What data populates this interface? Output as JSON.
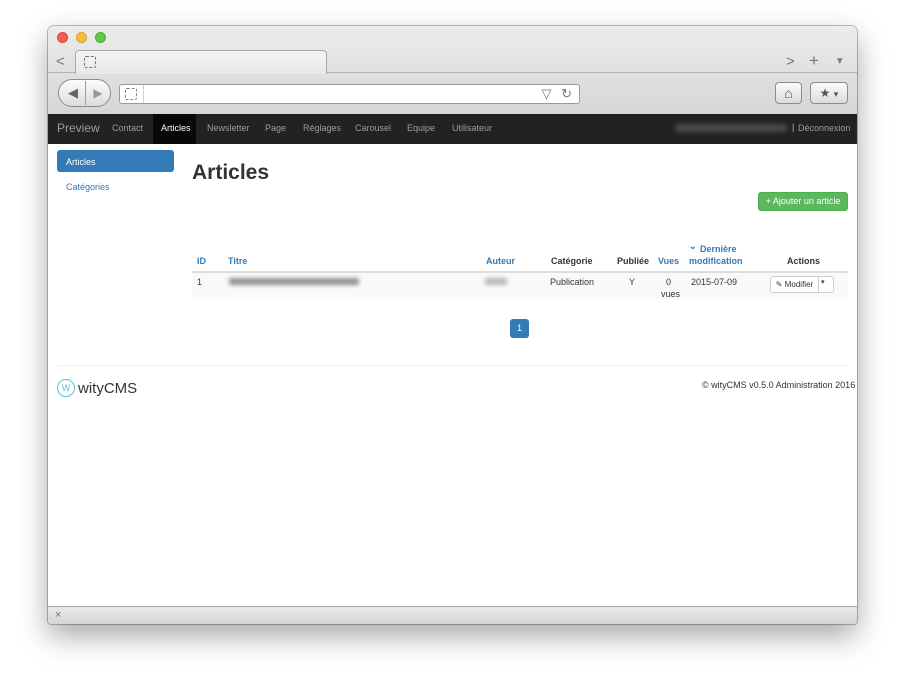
{
  "browser": {
    "tab_title": "",
    "url": "",
    "url_dropdown_icon": "▽",
    "reload_icon": "↻",
    "back_icon": "◀",
    "forward_icon": "▶",
    "tab_back_icon": "<",
    "tab_forward_icon": ">",
    "new_tab_icon": "+",
    "tab_menu_icon": "▾",
    "home_icon": "⌂",
    "bookmark_icon": "★",
    "bookmark_caret": "▾",
    "status_close_icon": "×"
  },
  "navbar": {
    "brand": "Preview",
    "items": [
      {
        "label": "Contact"
      },
      {
        "label": "Articles"
      },
      {
        "label": "Newsletter"
      },
      {
        "label": "Page"
      },
      {
        "label": "Réglages"
      },
      {
        "label": "Carousel"
      },
      {
        "label": "Equipe"
      },
      {
        "label": "Utilisateur"
      }
    ],
    "active": "Articles",
    "separator": "|",
    "logout": "Déconnexion"
  },
  "sidebar": {
    "items": [
      {
        "label": "Articles"
      },
      {
        "label": "Catégories"
      }
    ]
  },
  "main": {
    "title": "Articles",
    "add_button": "+ Ajouter un article",
    "table": {
      "headers": {
        "id": "ID",
        "title": "Titre",
        "author": "Auteur",
        "category": "Catégorie",
        "published": "Publiée",
        "views": "Vues",
        "modified_line1": "Dernière",
        "modified_line2": "modification",
        "sort_icon": "⌄",
        "actions": "Actions"
      },
      "rows": [
        {
          "id": "1",
          "category": "Publication",
          "published": "Y",
          "views_count": "0",
          "views_unit": "vues",
          "modified": "2015-07-09",
          "edit_label": "Modifier",
          "edit_icon": "✎",
          "caret": "▾"
        }
      ]
    },
    "pagination": [
      "1"
    ]
  },
  "footer": {
    "logo_letter": "W",
    "logo_text": "wityCMS",
    "copyright": "© wityCMS v0.5.0 Administration 2016"
  },
  "colors": {
    "navbar_bg": "#222222",
    "primary": "#337ab7",
    "success": "#5cb85c"
  }
}
